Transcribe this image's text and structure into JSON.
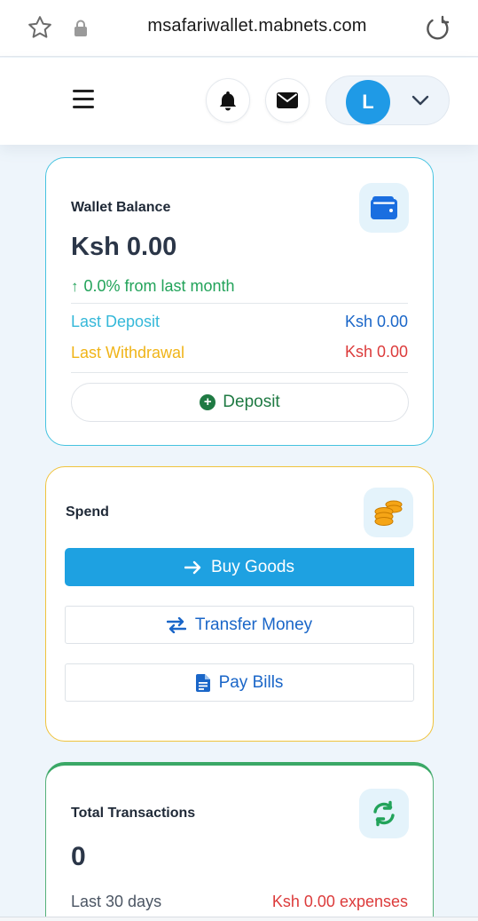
{
  "browser": {
    "url": "msafariwallet.mabnets.com"
  },
  "header": {
    "avatar_letter": "L"
  },
  "wallet": {
    "title": "Wallet Balance",
    "balance": "Ksh 0.00",
    "change": "0.0% from last month",
    "last_deposit_label": "Last Deposit",
    "last_deposit_value": "Ksh 0.00",
    "last_withdrawal_label": "Last Withdrawal",
    "last_withdrawal_value": "Ksh 0.00",
    "deposit_label": "Deposit"
  },
  "spend": {
    "title": "Spend",
    "buy_goods_label": "Buy Goods",
    "transfer_label": "Transfer Money",
    "pay_bills_label": "Pay Bills"
  },
  "transactions": {
    "title": "Total Transactions",
    "count": "0",
    "period": "Last 30 days",
    "expenses": "Ksh 0.00 expenses"
  },
  "colors": {
    "accent_blue": "#1ea1e1",
    "success_green": "#22a35a",
    "danger_red": "#dc3b3b",
    "warning_yellow": "#f0b418",
    "info_cyan": "#35b8d9"
  }
}
